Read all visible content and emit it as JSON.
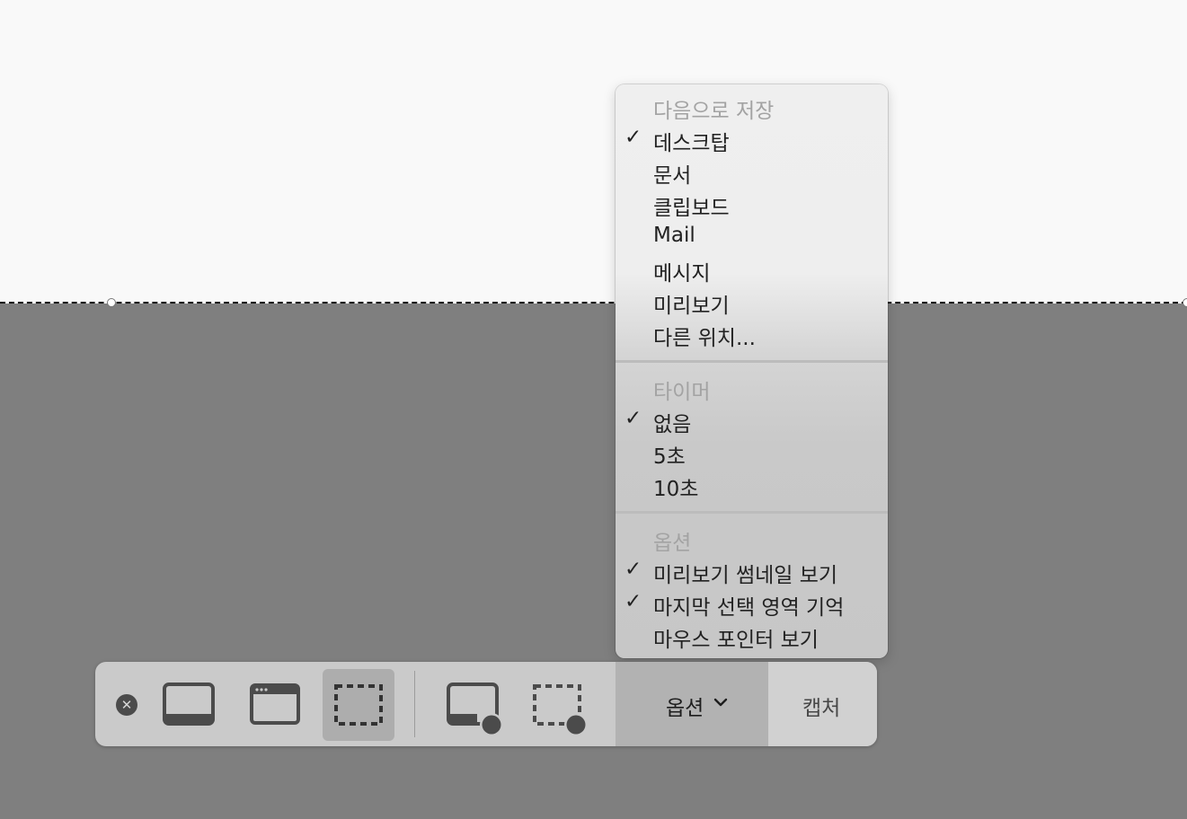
{
  "menu": {
    "save_to": {
      "header": "다음으로 저장",
      "items": [
        {
          "label": "데스크탑",
          "checked": true
        },
        {
          "label": "문서",
          "checked": false
        },
        {
          "label": "클립보드",
          "checked": false
        },
        {
          "label": "Mail",
          "checked": false
        },
        {
          "label": "메시지",
          "checked": false
        },
        {
          "label": "미리보기",
          "checked": false
        },
        {
          "label": "다른 위치...",
          "checked": false
        }
      ]
    },
    "timer": {
      "header": "타이머",
      "items": [
        {
          "label": "없음",
          "checked": true
        },
        {
          "label": "5초",
          "checked": false
        },
        {
          "label": "10초",
          "checked": false
        }
      ]
    },
    "options": {
      "header": "옵션",
      "items": [
        {
          "label": "미리보기 썸네일 보기",
          "checked": true
        },
        {
          "label": "마지막 선택 영역 기억",
          "checked": true
        },
        {
          "label": "마우스 포인터 보기",
          "checked": false
        }
      ]
    },
    "check_glyph": "✓"
  },
  "toolbar": {
    "close_glyph": "✕",
    "options_label": "옵션",
    "capture_label": "캡처",
    "active_tool": "capture-selected-portion",
    "icons": [
      "capture-entire-screen-icon",
      "capture-window-icon",
      "capture-selection-icon",
      "record-entire-screen-icon",
      "record-selection-icon",
      "chevron-down-icon"
    ]
  },
  "colors": {
    "screen_light": "#f9f9f9",
    "screen_dim": "#7f7f7f",
    "toolbar_bg": "#cacaca",
    "active_tool_bg": "#adadad",
    "options_bg": "#b2b2b2",
    "menu_header": "#a3a3a3",
    "icon": "#4b4b4b"
  }
}
